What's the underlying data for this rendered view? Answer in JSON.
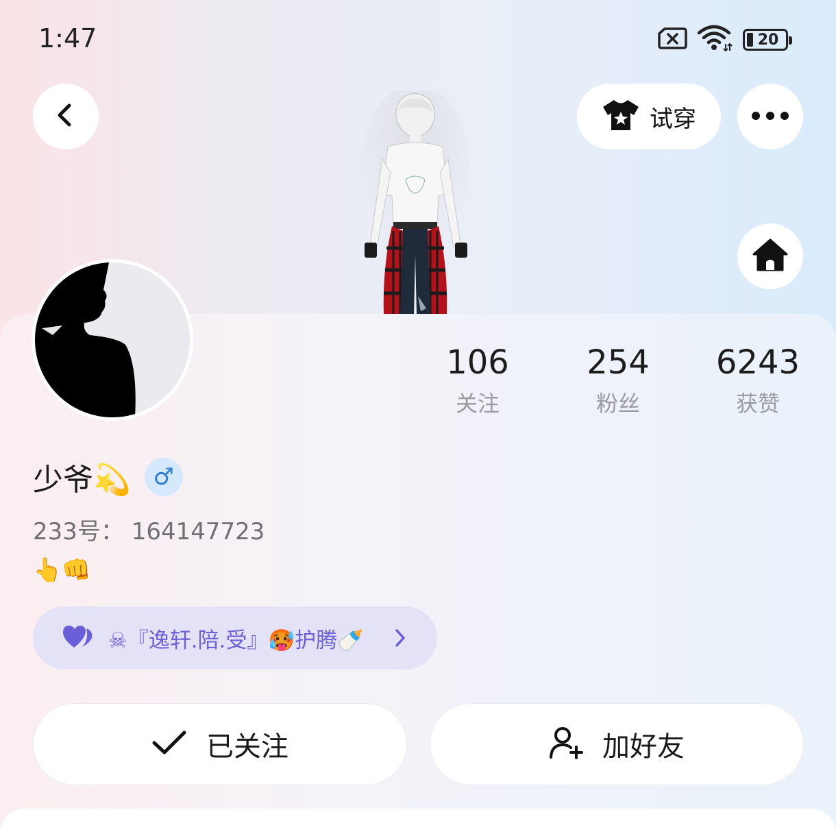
{
  "status_bar": {
    "time": "1:47",
    "battery": "20",
    "icons": [
      "sim-error-icon",
      "wifi-icon",
      "battery-icon"
    ]
  },
  "header": {
    "back_icon": "chevron-left-icon",
    "tryon_label": "试穿",
    "tryon_icon": "tshirt-icon",
    "more_icon": "more-horizontal-icon",
    "home_icon": "home-icon"
  },
  "stats": [
    {
      "value": "106",
      "label": "关注"
    },
    {
      "value": "254",
      "label": "粉丝"
    },
    {
      "value": "6243",
      "label": "获赞"
    }
  ],
  "profile": {
    "name": "少爷💫",
    "gender_symbol": "♂",
    "uid": "233号：  164147723",
    "bio": "👆👊"
  },
  "group": {
    "icon": "heart-icon",
    "text": "☠『逸轩.陪.受』🥵护腾🍼"
  },
  "actions": {
    "follow_label": "已关注",
    "add_friend_label": "加好友"
  },
  "colors": {
    "accent_purple": "#6b5fd8",
    "gender_blue": "#2f7fd6",
    "pill_bg": "#e4e2f6"
  }
}
